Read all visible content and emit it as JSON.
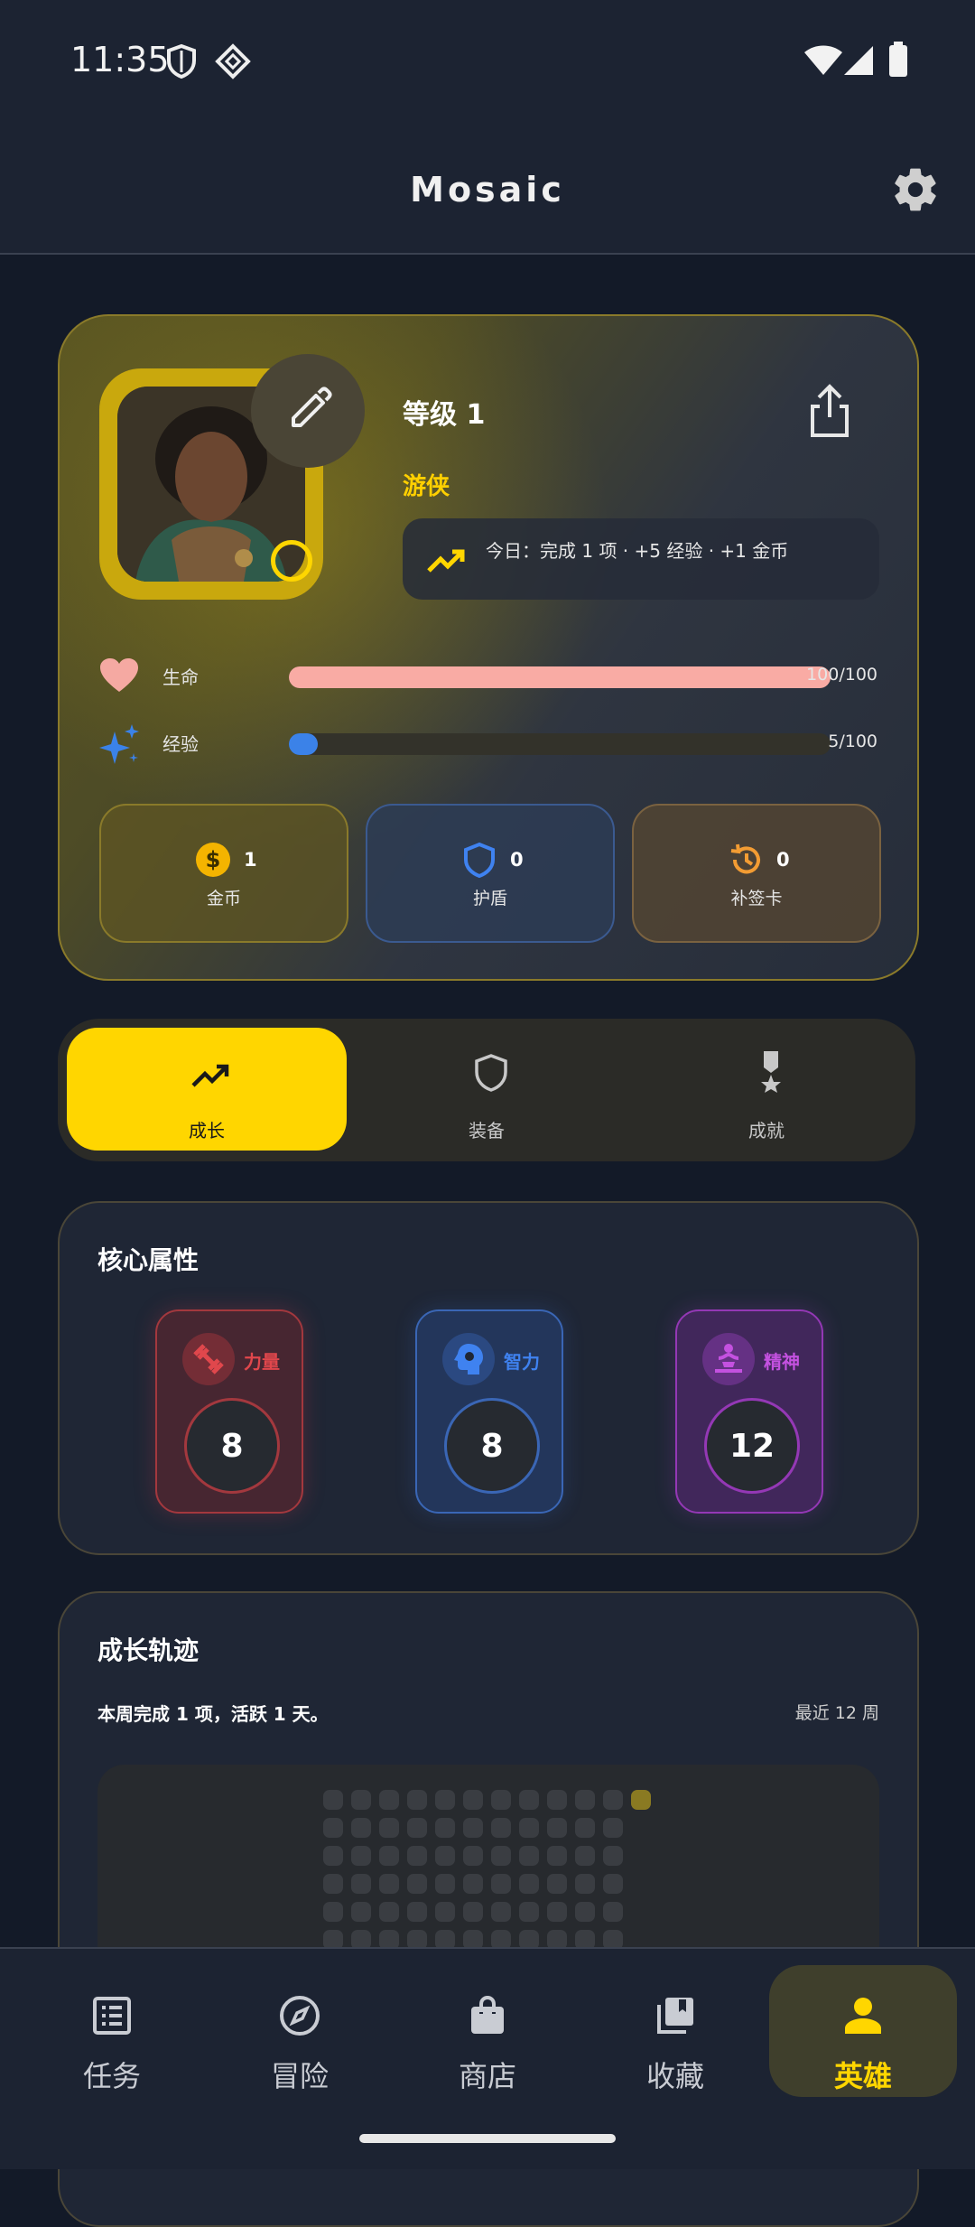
{
  "status_bar": {
    "time": "11:35"
  },
  "app_bar": {
    "title": "Mosaic"
  },
  "hero": {
    "level": "等级 1",
    "class_name": "游侠",
    "today_summary": "今日：完成 1 项 · +5 经验 · +1 金币",
    "stats": [
      {
        "label": "生命",
        "value_text": "100/100",
        "fraction": 1.0,
        "color": "#f9aba4"
      },
      {
        "label": "经验",
        "value_text": "5/100",
        "fraction": 0.05,
        "color": "#3b82e8"
      }
    ],
    "resources": [
      {
        "label": "金币",
        "value": "1",
        "icon": "dollar-coin-icon"
      },
      {
        "label": "护盾",
        "value": "0",
        "icon": "shield-icon"
      },
      {
        "label": "补签卡",
        "value": "0",
        "icon": "history-icon"
      }
    ]
  },
  "tabs": [
    {
      "label": "成长",
      "icon": "trending-up-icon",
      "selected": true
    },
    {
      "label": "装备",
      "icon": "shield-outline-icon",
      "selected": false
    },
    {
      "label": "成就",
      "icon": "medal-icon",
      "selected": false
    }
  ],
  "core_attributes": {
    "title": "核心属性",
    "items": [
      {
        "name": "力量",
        "value": "8",
        "color": "#e0474c",
        "icon": "dumbbell-icon"
      },
      {
        "name": "智力",
        "value": "8",
        "color": "#3f82f0",
        "icon": "brain-icon"
      },
      {
        "name": "精神",
        "value": "12",
        "color": "#c451e0",
        "icon": "meditation-icon"
      }
    ]
  },
  "growth": {
    "title": "成长轨迹",
    "summary": "本周完成 1 项，活跃 1 天。",
    "range_label": "最近 12 周"
  },
  "bottom_nav": [
    {
      "label": "任务",
      "icon": "list-icon",
      "selected": false
    },
    {
      "label": "冒险",
      "icon": "compass-icon",
      "selected": false
    },
    {
      "label": "商店",
      "icon": "shopping-bag-icon",
      "selected": false
    },
    {
      "label": "收藏",
      "icon": "collection-icon",
      "selected": false
    },
    {
      "label": "英雄",
      "icon": "person-icon",
      "selected": true
    }
  ],
  "colors": {
    "accent": "#ffd600",
    "background": "#131a28"
  }
}
